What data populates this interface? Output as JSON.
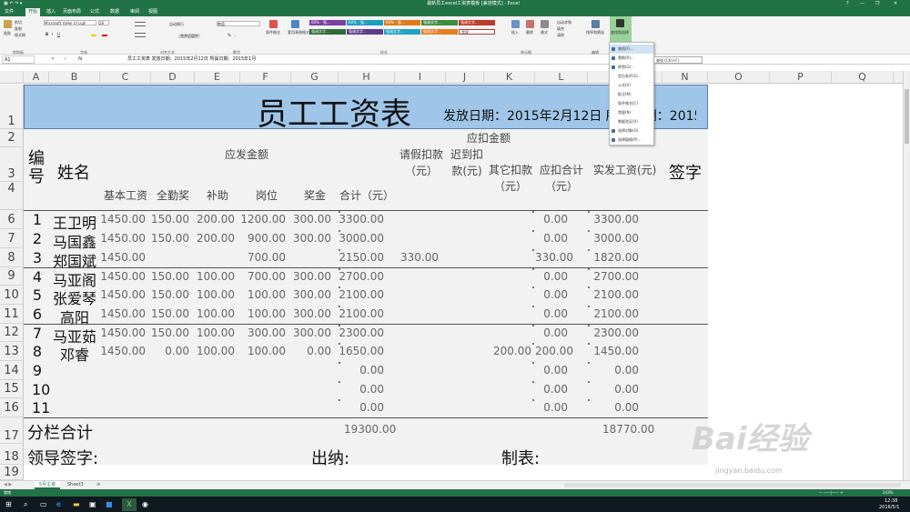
{
  "window": {
    "title": "最新员工excel工资表模板 [兼容模式] - Excel",
    "controls": [
      "?",
      "—",
      "❐",
      "✕"
    ]
  },
  "ribbon_tabs": [
    "文件",
    "开始",
    "插入",
    "页面布局",
    "公式",
    "数据",
    "审阅",
    "视图"
  ],
  "ribbon": {
    "clipboard": {
      "paste": "粘贴",
      "cut": "剪切",
      "copy": "复制",
      "format_painter": "格式刷",
      "group": "剪贴板"
    },
    "font": {
      "name": "Microsoft YaHei UI Ligh",
      "size": "28",
      "bold": "B",
      "italic": "I",
      "underline": "U",
      "group": "字体"
    },
    "alignment": {
      "wrap": "自动换行",
      "merge": "合并后居中",
      "group": "对齐方式"
    },
    "number": {
      "format": "数值",
      "percent": "%",
      "comma": ",",
      "group": "数字"
    },
    "styles": {
      "conditional": "条件格式",
      "table": "套用表格格式",
      "boxes": [
        "60% - 强...",
        "60% - 强...",
        "60% - 强...",
        "强调文字...",
        "强调文字...",
        "强调文字...",
        "强调文字...",
        "强调文字...",
        "强调文字...",
        "常规"
      ],
      "group": "样式"
    },
    "cells": {
      "insert": "插入",
      "delete": "删除",
      "format": "格式",
      "group": "单元格"
    },
    "editing": {
      "autosum": "自动求和",
      "fill": "填充",
      "clear": "清除",
      "sort": "排序和筛选",
      "find": "查找和选择",
      "group": "编辑"
    }
  },
  "formula_bar": {
    "name_box": "A1",
    "fx": "fx",
    "content": "员工工资表     发放日期：2015年2月12日 所属日期：2015年1月"
  },
  "columns": [
    "A",
    "B",
    "C",
    "D",
    "E",
    "F",
    "G",
    "H",
    "I",
    "J",
    "K",
    "L",
    "M",
    "N",
    "O",
    "P",
    "Q"
  ],
  "rows": [
    "1",
    "2",
    "3",
    "4",
    "6",
    "7",
    "8",
    "9",
    "10",
    "11",
    "12",
    "13",
    "14",
    "15",
    "16",
    "17",
    "18",
    "19"
  ],
  "sheet": {
    "title": "员工工资表",
    "date_line": "发放日期：2015年2月12日 所属日期：2015年1月",
    "headers": {
      "id": "编号",
      "name": "姓名",
      "gross_group": "应发金额",
      "deduct_group": "应扣金额",
      "base": "基本工资",
      "attendance": "全勤奖",
      "subsidy": "补助",
      "post": "岗位",
      "bonus": "奖金",
      "total": "合计（元）",
      "leave": "请假扣款（元）",
      "late": "迟到扣款(元)",
      "other": "其它扣款（元）",
      "deduct_total": "应扣合计（元）",
      "net": "实发工资(元)",
      "sign": "签字"
    },
    "data": [
      [
        "1",
        "王卫明",
        "1450.00",
        "150.00",
        "200.00",
        "1200.00",
        "300.00",
        "3300.00",
        "",
        "",
        "",
        "0.00",
        "3300.00"
      ],
      [
        "2",
        "马国鑫",
        "1450.00",
        "150.00",
        "200.00",
        "900.00",
        "300.00",
        "3000.00",
        "",
        "",
        "",
        "0.00",
        "3000.00"
      ],
      [
        "3",
        "郑国斌",
        "1450.00",
        "",
        "",
        "700.00",
        "",
        "2150.00",
        "330.00",
        "",
        "",
        "330.00",
        "1820.00"
      ],
      [
        "4",
        "马亚阁",
        "1450.00",
        "150.00",
        "100.00",
        "700.00",
        "300.00",
        "2700.00",
        "",
        "",
        "",
        "0.00",
        "2700.00"
      ],
      [
        "5",
        "张爱琴",
        "1450.00",
        "150.00",
        "100.00",
        "100.00",
        "300.00",
        "2100.00",
        "",
        "",
        "",
        "0.00",
        "2100.00"
      ],
      [
        "6",
        "高阳",
        "1450.00",
        "150.00",
        "100.00",
        "100.00",
        "300.00",
        "2100.00",
        "",
        "",
        "",
        "0.00",
        "2100.00"
      ],
      [
        "7",
        "马亚茹",
        "1450.00",
        "150.00",
        "100.00",
        "300.00",
        "300.00",
        "2300.00",
        "",
        "",
        "",
        "0.00",
        "2300.00"
      ],
      [
        "8",
        "邓睿",
        "1450.00",
        "0.00",
        "100.00",
        "100.00",
        "0.00",
        "1650.00",
        "",
        "",
        "200.00",
        "200.00",
        "1450.00"
      ],
      [
        "9",
        "",
        "",
        "",
        "",
        "",
        "",
        "0.00",
        "",
        "",
        "",
        "0.00",
        "0.00"
      ],
      [
        "10",
        "",
        "",
        "",
        "",
        "",
        "",
        "0.00",
        "",
        "",
        "",
        "0.00",
        "0.00"
      ],
      [
        "11",
        "",
        "",
        "",
        "",
        "",
        "",
        "0.00",
        "",
        "",
        "",
        "0.00",
        "0.00"
      ]
    ],
    "subtotal_label": "分栏合计",
    "subtotal_total": "19300.00",
    "subtotal_net": "18770.00",
    "footer": {
      "leader": "领导签字:",
      "cashier": "出纳:",
      "maker": "制表:"
    }
  },
  "dropdown_menu": [
    "查找(F)...",
    "替换(R)...",
    "转到(G)...",
    "定位条件(S)...",
    "公式(U)",
    "批注(M)",
    "条件格式(C)",
    "常量(N)",
    "数据验证(V)",
    "选择对象(O)",
    "选择窗格(P)..."
  ],
  "tooltip": "查找 (Ctrl+F)",
  "sheet_tabs": [
    "5月工资",
    "Sheet3"
  ],
  "status": {
    "left": "就绪",
    "zoom": "243%"
  },
  "taskbar": {
    "time": "12:38",
    "date": "2016/5/1"
  },
  "watermark": {
    "brand": "Bai经验",
    "url": "jingyan.baidu.com"
  },
  "colors": {
    "excel_green": "#217346",
    "banner_blue": "#9fc5e8",
    "grid_gray": "#f2f2f2"
  }
}
